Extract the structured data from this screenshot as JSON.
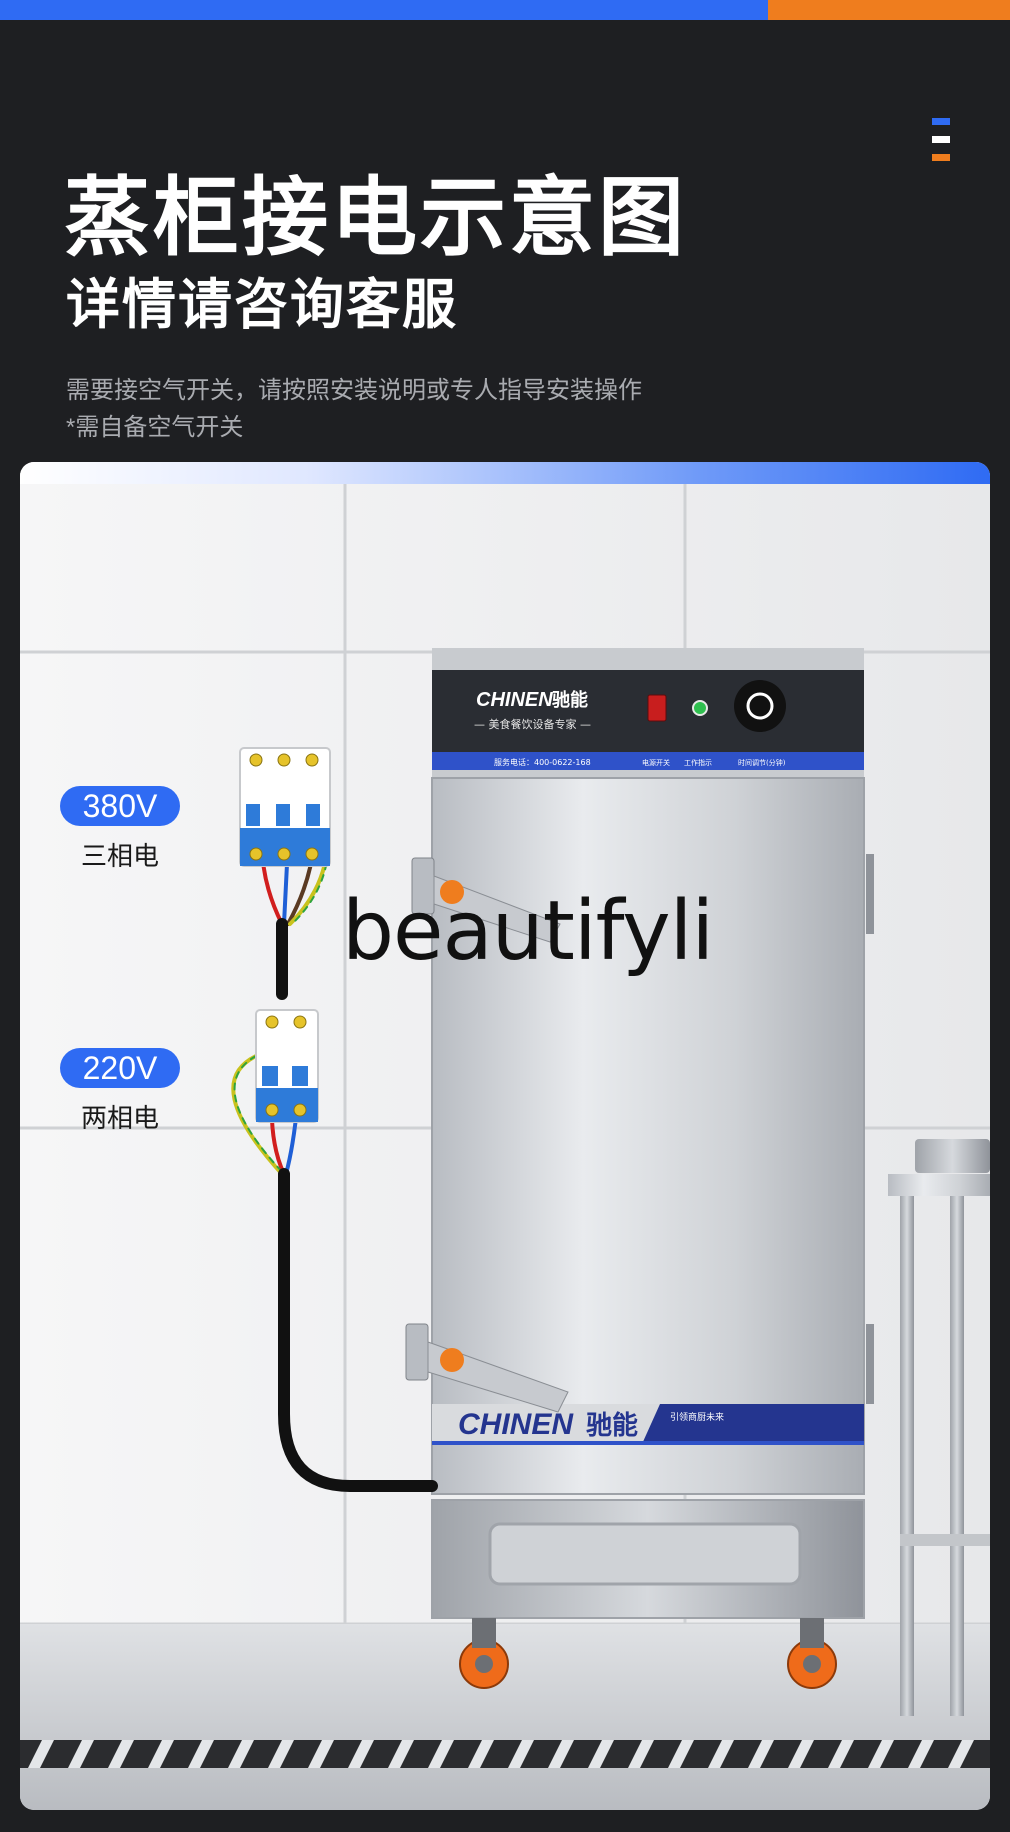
{
  "header": {
    "title": "蒸柜接电示意图",
    "subtitle": "详情请咨询客服",
    "note_line1": "需要接空气开关，请按照安装说明或专人指导安装操作",
    "note_line2": "*需自备空气开关"
  },
  "colors": {
    "background": "#1e1f22",
    "accent_blue": "#2f6bf3",
    "accent_orange": "#ef7d1e"
  },
  "diagram": {
    "label_380": "380V",
    "phase_380": "三相电",
    "label_220": "220V",
    "phase_220": "两相电",
    "watermark": "beautifyli"
  },
  "cabinet": {
    "brand": "CHINEN",
    "brand_cn": "驰能",
    "slogan": "— 美食餐饮设备专家 —",
    "service_phone": "服务电话：400-0622-168",
    "power_switch": "电源开关",
    "work_indicator": "工作指示",
    "timer": "时间调节(分钟)",
    "door_slogan": "引领商厨未来"
  }
}
